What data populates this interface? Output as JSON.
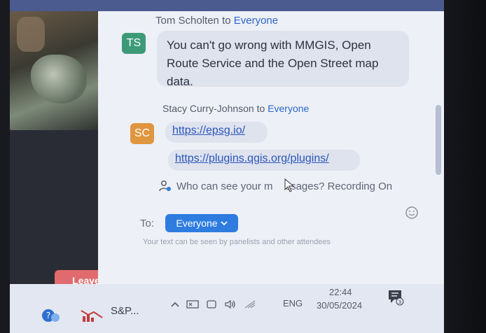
{
  "chat": {
    "messages": [
      {
        "sender": "Tom Scholten",
        "to_word": "to",
        "recipient": "Everyone",
        "initials": "TS",
        "avatar_color": "#3d9a78",
        "text": "You can't go wrong with MMGIS, Open Route Service and the Open Street map data."
      },
      {
        "sender": "Stacy Curry-Johnson",
        "to_word": "to",
        "recipient": "Everyone",
        "initials": "SC",
        "avatar_color": "#e0953f",
        "links": [
          "https://epsg.io/",
          "https://plugins.qgis.org/plugins/"
        ]
      }
    ],
    "privacy_notice": "Who can see your messages? Recording On",
    "privacy_notice_visible": "Who can see your m",
    "privacy_notice_tail": "ssages? Recording On",
    "to_label": "To:",
    "recipient_select": "Everyone",
    "hint": "Your text can be seen by panelists and other attendees"
  },
  "controls": {
    "leave_label": "Leave"
  },
  "taskbar": {
    "app_label": "S&P...",
    "language": "ENG",
    "time": "22:44",
    "date": "30/05/2024",
    "notification_count": "3"
  },
  "colors": {
    "accent": "#2e7ce0",
    "leave": "#e06a6d",
    "link": "#2a55b8"
  }
}
